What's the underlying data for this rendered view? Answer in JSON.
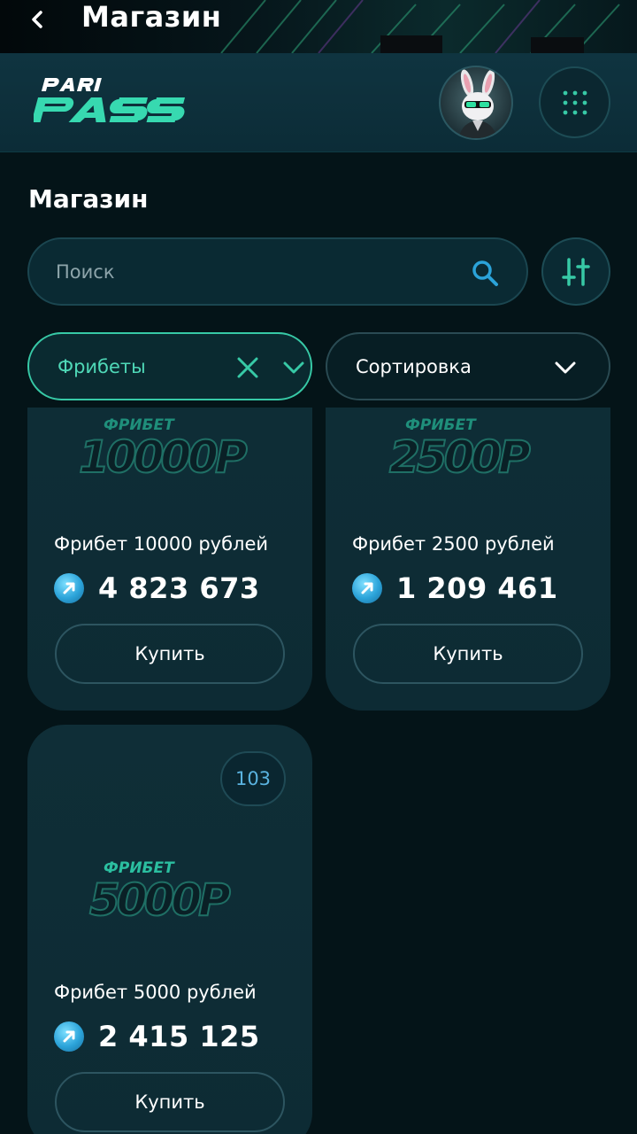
{
  "topbar": {
    "title": "Магазин"
  },
  "brand": {
    "name": "PARI PASS"
  },
  "page": {
    "title": "Магазин"
  },
  "search": {
    "placeholder": "Поиск",
    "value": ""
  },
  "filters": {
    "category_label": "Фрибеты",
    "sort_label": "Сортировка"
  },
  "colors": {
    "accent": "#37c9a6",
    "coin": "#2ba3d9",
    "background": "#041418"
  },
  "products": [
    {
      "art_caption": "ФРИБЕТ",
      "art_amount": "10000Р",
      "name": "Фрибет 10000 рублей",
      "price": "4 823 673",
      "buy_label": "Купить",
      "badge": ""
    },
    {
      "art_caption": "ФРИБЕТ",
      "art_amount": "2500Р",
      "name": "Фрибет 2500 рублей",
      "price": "1 209 461",
      "buy_label": "Купить",
      "badge": ""
    },
    {
      "art_caption": "ФРИБЕТ",
      "art_amount": "5000Р",
      "name": "Фрибет 5000 рублей",
      "price": "2 415 125",
      "buy_label": "Купить",
      "badge": "103"
    }
  ],
  "icons": [
    "back-arrow-icon",
    "grid-menu-icon",
    "search-icon",
    "filter-sliders-icon",
    "close-icon",
    "chevron-down-icon",
    "coin-arrow-icon"
  ]
}
